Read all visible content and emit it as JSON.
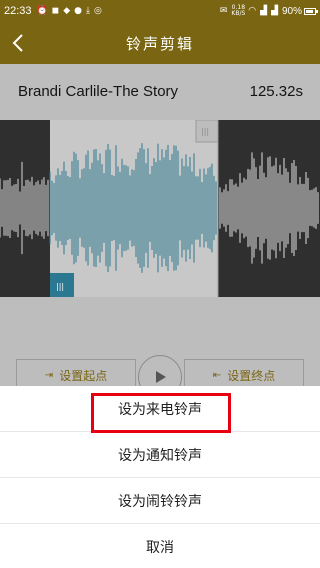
{
  "status_bar": {
    "time": "22:33",
    "speed_top": "0.18",
    "speed_bottom": "KB/S",
    "battery": "90%",
    "battery_level": 0.9
  },
  "header": {
    "title": "铃声剪辑"
  },
  "song": {
    "name": "Brandi Carlile-The Story",
    "duration": "125.32s"
  },
  "controls": {
    "set_start_label": "设置起点",
    "set_end_label": "设置终点"
  },
  "sheet": {
    "items": [
      {
        "label": "设为来电铃声"
      },
      {
        "label": "设为通知铃声"
      },
      {
        "label": "设为闹铃铃声"
      },
      {
        "label": "取消"
      }
    ]
  },
  "colors": {
    "header": "#7a6512",
    "wave_selected": "#2b7890",
    "wave_dark": "#2a2a2a",
    "highlight": "#e60012"
  }
}
